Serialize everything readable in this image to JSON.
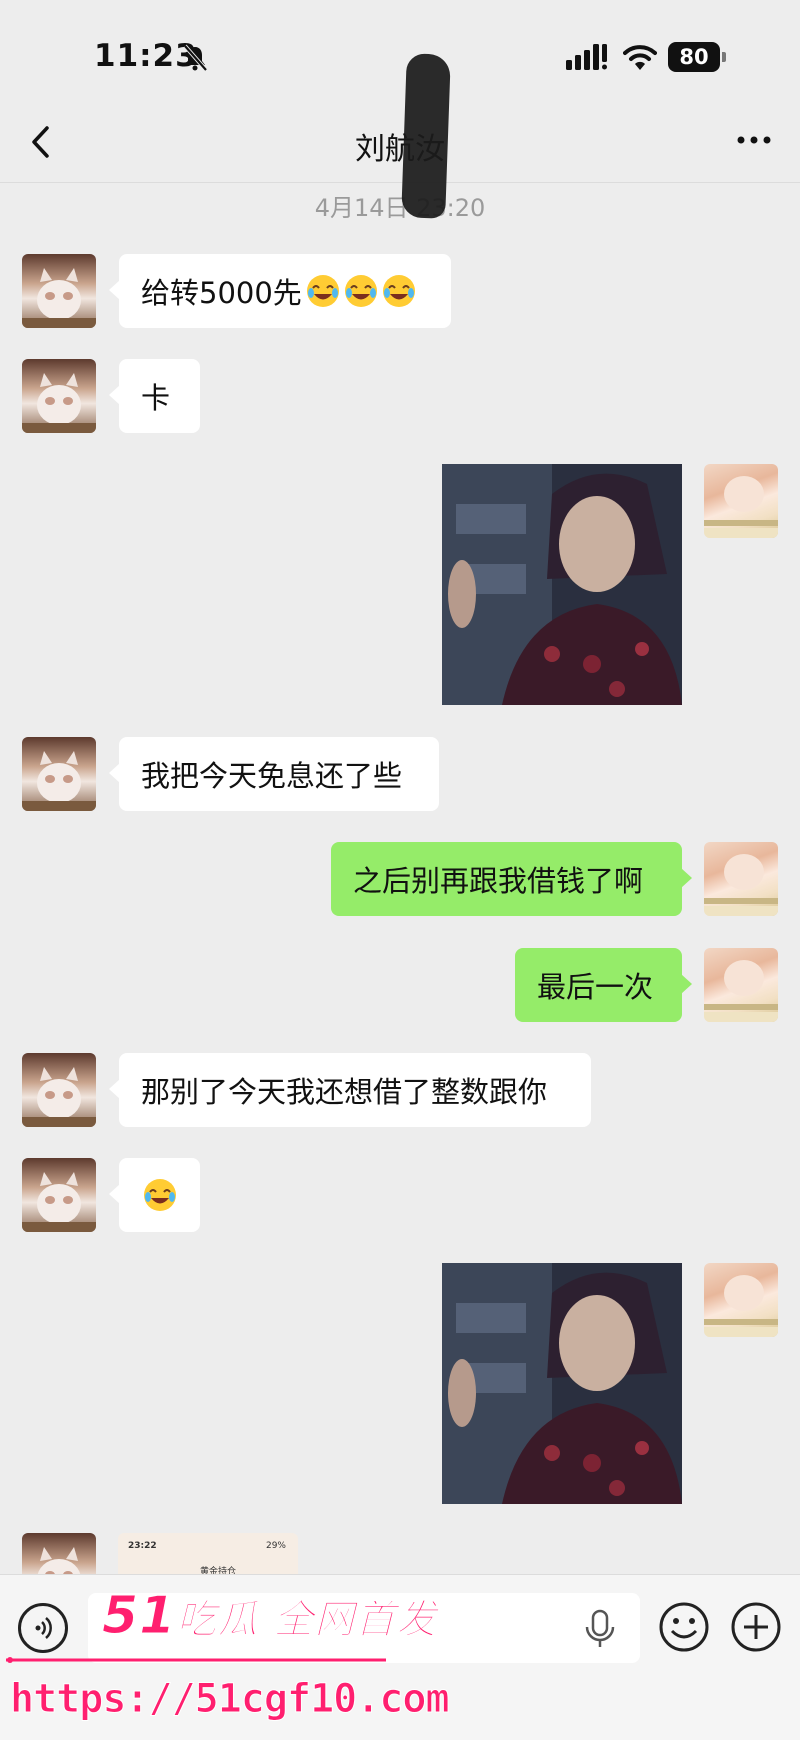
{
  "status": {
    "time": "11:23",
    "battery": "80"
  },
  "header": {
    "title": "刘航汝"
  },
  "timestamp": "4月14日 23:20",
  "messages": [
    {
      "side": "left",
      "text": "给转5000先",
      "emoji_count": 3,
      "emoji": "tears-of-joy"
    },
    {
      "side": "left",
      "text": "卡"
    },
    {
      "side": "right",
      "type": "image",
      "content": "elderly-woman-photo"
    },
    {
      "side": "left",
      "text": "我把今天免息还了些"
    },
    {
      "side": "right",
      "text": "之后别再跟我借钱了啊"
    },
    {
      "side": "right",
      "text": "最后一次"
    },
    {
      "side": "left",
      "text": "那别了今天我还想借了整数跟你"
    },
    {
      "side": "left",
      "type": "emoji",
      "emoji": "tears-of-joy"
    },
    {
      "side": "right",
      "type": "image",
      "content": "elderly-woman-photo"
    },
    {
      "side": "left",
      "type": "screenshot",
      "thumb": {
        "time": "23:22",
        "title": "黄金持仓",
        "battery": "29%"
      }
    }
  ],
  "watermark": {
    "brand_num": "51",
    "brand_text": "吃瓜 全网首发",
    "url": "https://51cgf10.com"
  },
  "colors": {
    "bg": "#ededed",
    "bubble_self": "#95ec69",
    "bubble_other": "#ffffff",
    "watermark": "#ff1f6f"
  }
}
